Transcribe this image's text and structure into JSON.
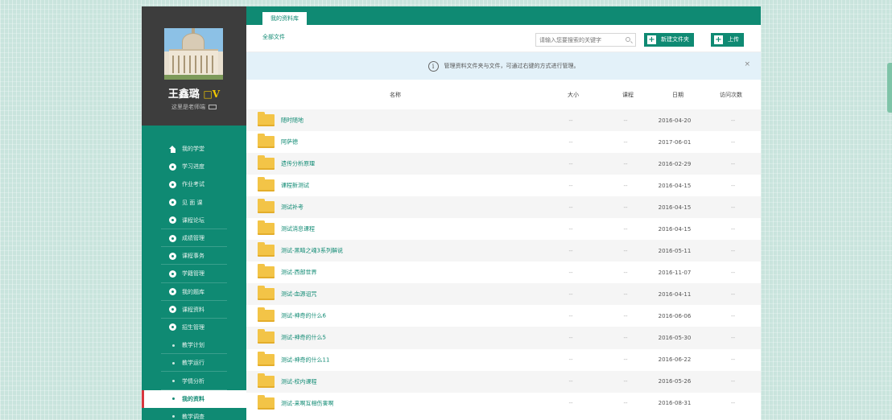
{
  "profile": {
    "name": "王鑫璐",
    "badge": "□V",
    "subtitle": "这里是老师端"
  },
  "nav": [
    {
      "label": "我的学堂",
      "icon": "home-icon",
      "sub": false
    },
    {
      "label": "学习进度",
      "icon": "progress-icon",
      "sub": false
    },
    {
      "label": "作业考试",
      "icon": "pencil-icon",
      "sub": false
    },
    {
      "label": "见 面 课",
      "icon": "meeting-icon",
      "sub": false
    },
    {
      "label": "课程论坛",
      "icon": "forum-icon",
      "sub": false
    },
    {
      "label": "成绩管理",
      "icon": "check-icon",
      "sub": false
    },
    {
      "label": "课程事务",
      "icon": "gear-icon",
      "sub": false
    },
    {
      "label": "学籍管理",
      "icon": "user-icon",
      "sub": false
    },
    {
      "label": "我的题库",
      "icon": "question-bank-icon",
      "sub": false
    },
    {
      "label": "课程资料",
      "icon": "book-icon",
      "sub": false
    },
    {
      "label": "招生管理",
      "icon": "enroll-icon",
      "sub": false
    },
    {
      "label": "教学计划",
      "sub": true
    },
    {
      "label": "教学运行",
      "sub": true
    },
    {
      "label": "学情分析",
      "sub": true
    },
    {
      "label": "我的资料",
      "sub": true,
      "active": true
    },
    {
      "label": "教学调查",
      "sub": true
    }
  ],
  "tab": {
    "label": "我的资料库"
  },
  "toolbar": {
    "breadcrumb": "全部文件",
    "search_placeholder": "请输入您要搜索的关键字",
    "new_folder_label": "新建文件夹",
    "upload_label": "上传",
    "plus": "+"
  },
  "notice": {
    "text": "管理资料文件夹与文件，可通过右键的方式进行管理。",
    "info": "i",
    "close": "×"
  },
  "table": {
    "headers": {
      "name": "名称",
      "size": "大小",
      "course": "课程",
      "date": "日期",
      "visits": "访问次数"
    },
    "rows": [
      {
        "name": "随时随地",
        "size": "--",
        "course": "--",
        "date": "2016-04-20",
        "visits": "--"
      },
      {
        "name": "阿萨德",
        "size": "--",
        "course": "--",
        "date": "2017-06-01",
        "visits": "--"
      },
      {
        "name": "遗传分析原理",
        "size": "--",
        "course": "--",
        "date": "2016-02-29",
        "visits": "--"
      },
      {
        "name": "课程新测试",
        "size": "--",
        "course": "--",
        "date": "2016-04-15",
        "visits": "--"
      },
      {
        "name": "测试补考",
        "size": "--",
        "course": "--",
        "date": "2016-04-15",
        "visits": "--"
      },
      {
        "name": "测试消息课程",
        "size": "--",
        "course": "--",
        "date": "2016-04-15",
        "visits": "--"
      },
      {
        "name": "测试-黑暗之魂3系列解说",
        "size": "--",
        "course": "--",
        "date": "2016-05-11",
        "visits": "--"
      },
      {
        "name": "测试-西部世界",
        "size": "--",
        "course": "--",
        "date": "2016-11-07",
        "visits": "--"
      },
      {
        "name": "测试-血源诅咒",
        "size": "--",
        "course": "--",
        "date": "2016-04-11",
        "visits": "--"
      },
      {
        "name": "测试-神奇的什么6",
        "size": "--",
        "course": "--",
        "date": "2016-06-06",
        "visits": "--"
      },
      {
        "name": "测试-神奇的什么5",
        "size": "--",
        "course": "--",
        "date": "2016-05-30",
        "visits": "--"
      },
      {
        "name": "测试-神奇的什么11",
        "size": "--",
        "course": "--",
        "date": "2016-06-22",
        "visits": "--"
      },
      {
        "name": "测试-校内课程",
        "size": "--",
        "course": "--",
        "date": "2016-05-26",
        "visits": "--"
      },
      {
        "name": "测试-来啊互相伤害啊",
        "size": "--",
        "course": "--",
        "date": "2016-08-31",
        "visits": "--"
      }
    ]
  },
  "colors": {
    "brand": "#0f8a73",
    "sidebar_dark": "#3d3d3d",
    "active_marker": "#d9363e",
    "folder": "#f3c447",
    "notice_bg": "#e3f1f9"
  }
}
